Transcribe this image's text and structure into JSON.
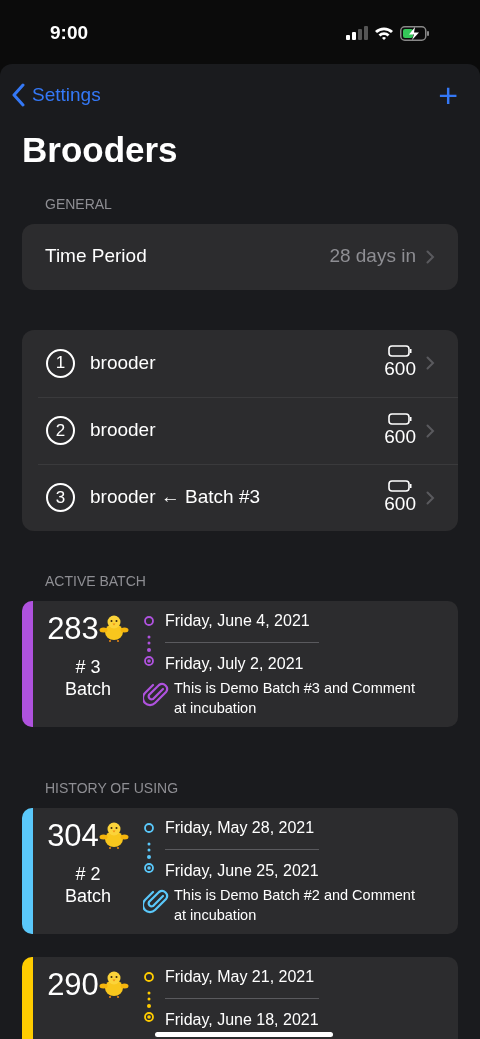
{
  "status_bar": {
    "time": "9:00"
  },
  "nav": {
    "back": "Settings",
    "add": "+"
  },
  "title": "Brooders",
  "general": {
    "header": "GENERAL",
    "rows": [
      {
        "label": "Time Period",
        "value": "28 days in"
      }
    ]
  },
  "brooders": [
    {
      "number": "1",
      "name": "brooder",
      "capacity": "600"
    },
    {
      "number": "2",
      "name": "brooder",
      "capacity": "600"
    },
    {
      "number": "3",
      "name": "brooder ← Batch #3",
      "capacity": "600"
    }
  ],
  "active_batch": {
    "header": "ACTIVE BATCH",
    "batches": [
      {
        "count": "283",
        "batch_no": "# 3",
        "batch_label": "Batch",
        "start": "Friday, June 4, 2021",
        "end": "Friday, July 2, 2021",
        "comment": "This is Demo Batch #3 and Comment at incubation",
        "color": "#af52de"
      }
    ]
  },
  "history": {
    "header": "HISTORY OF USING",
    "batches": [
      {
        "count": "304",
        "batch_no": "# 2",
        "batch_label": "Batch",
        "start": "Friday, May 28, 2021",
        "end": "Friday, June 25, 2021",
        "comment": "This is Demo Batch #2 and Comment at incubation",
        "color": "#5ac8fa"
      },
      {
        "count": "290",
        "start": "Friday, May 21, 2021",
        "end": "Friday, June 18, 2021",
        "color": "#ffcc00"
      }
    ]
  }
}
